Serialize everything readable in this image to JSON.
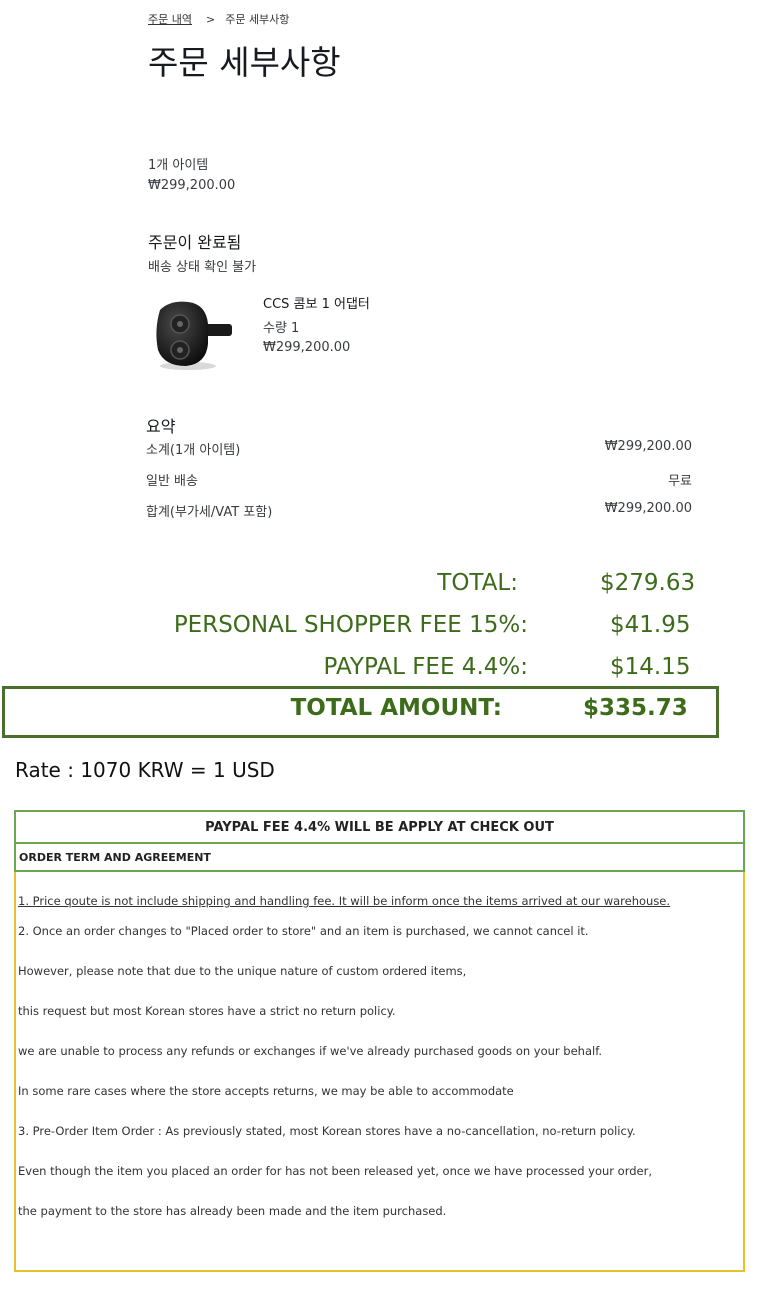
{
  "breadcrumb": {
    "link": "주문 내역",
    "separator": ">",
    "current": "주문 세부사항"
  },
  "page_title": "주문 세부사항",
  "order_summary": {
    "item_count": "1개 아이템",
    "price": "₩299,200.00"
  },
  "status": {
    "title": "주문이 완료됨",
    "subtitle": "배송 상태 확인 불가"
  },
  "product": {
    "name": "CCS 콤보 1 어댑터",
    "quantity": "수량 1",
    "price": "₩299,200.00",
    "image_icon": "ccs-adapter-image"
  },
  "summary": {
    "title": "요약",
    "rows": [
      {
        "label": "소계(1개 아이템)",
        "value": "₩299,200.00"
      },
      {
        "label": "일반 배송",
        "value": "무료"
      },
      {
        "label": "합계(부가세/VAT 포함)",
        "value": "₩299,200.00"
      }
    ]
  },
  "fees": {
    "total_label": "TOTAL:",
    "total_value": "$279.63",
    "shopper_label": "PERSONAL SHOPPER FEE 15%:",
    "shopper_value": "$41.95",
    "paypal_label": "PAYPAL FEE 4.4%:",
    "paypal_value": "$14.15",
    "grand_label": "TOTAL AMOUNT:",
    "grand_value": "$335.73"
  },
  "rate": "Rate : 1070 KRW = 1 USD",
  "terms": {
    "header": "PAYPAL FEE 4.4% WILL BE APPLY AT CHECK OUT",
    "subheader": "ORDER TERM AND AGREEMENT",
    "lines": [
      "1. Price qoute is not include shipping and handling fee. It will be inform once the items arrived at our warehouse.",
      "2. Once an order changes to \"Placed order to store\" and an item is purchased, we cannot cancel it.",
      "However, please note that due to the unique nature of custom ordered items,",
      "this request but most Korean stores have a strict no return policy.",
      "we are unable to process any refunds or exchanges if we've already purchased goods on your behalf.",
      "In some rare cases where the store accepts returns, we may be able to accommodate",
      "3. Pre-Order Item Order :   As previously stated, most Korean stores have a no-cancellation, no-return policy.",
      "Even though the item you placed an order for has not been released yet, once we have processed your order,",
      "the payment to the store has already been made and the item purchased."
    ]
  },
  "colors": {
    "fee_green": "#3c6b1a",
    "box_green": "#4a6e2b",
    "terms_yellow": "#e6c32b",
    "terms_green": "#6aa84f"
  }
}
